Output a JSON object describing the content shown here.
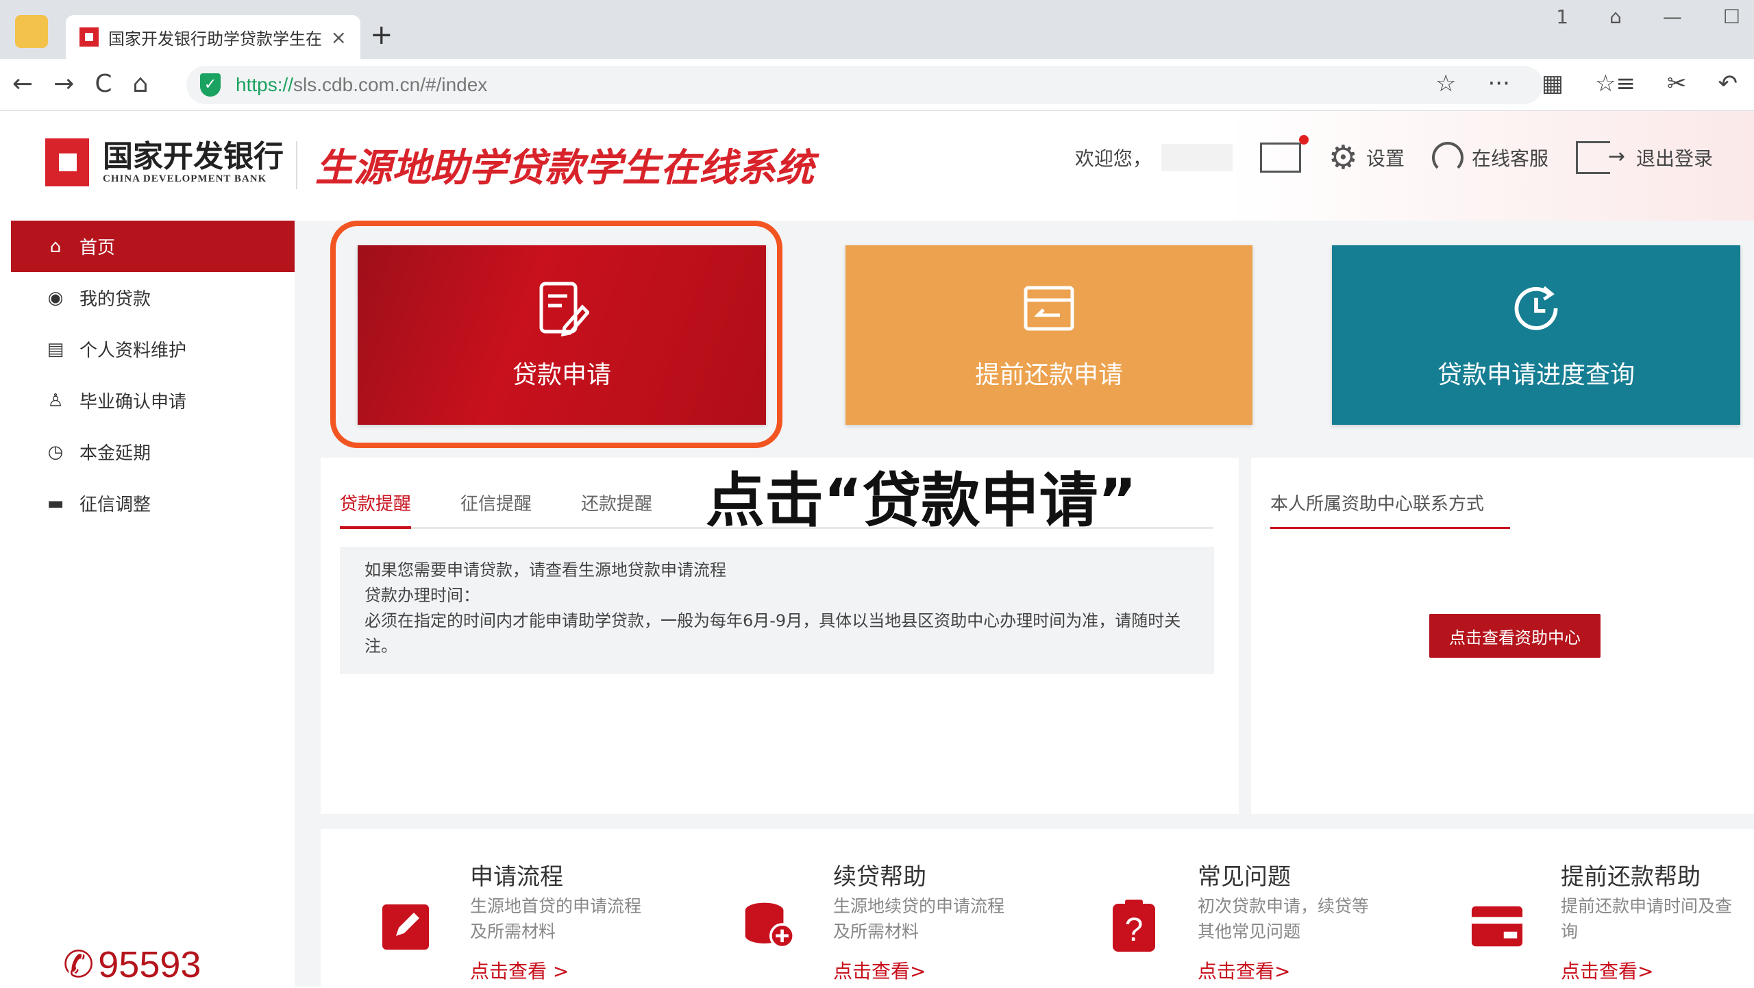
{
  "browser": {
    "tab_title": "国家开发银行助学贷款学生在",
    "tab_close": "×",
    "new_tab": "+",
    "url_proto": "https://",
    "url_rest": "sls.cdb.com.cn/#/index",
    "window_controls": [
      "1",
      "⌂",
      "—",
      "☐"
    ],
    "nav": [
      "←",
      "→",
      "C",
      "⌂"
    ],
    "addr_icons": [
      "☆",
      "···",
      "▦",
      "☆≡",
      "✂",
      "↶"
    ]
  },
  "header": {
    "bank_name": "国家开发银行",
    "bank_eng": "CHINA DEVELOPMENT BANK",
    "system_name": "生源地助学贷款学生在线系统",
    "welcome": "欢迎您，",
    "settings": "设置",
    "service": "在线客服",
    "logout": "退出登录"
  },
  "sidebar": {
    "items": [
      {
        "label": "首页",
        "icon": "home-icon"
      },
      {
        "label": "我的贷款",
        "icon": "loan-user-icon"
      },
      {
        "label": "个人资料维护",
        "icon": "id-card-icon"
      },
      {
        "label": "毕业确认申请",
        "icon": "graduate-icon"
      },
      {
        "label": "本金延期",
        "icon": "clock-icon"
      },
      {
        "label": "征信调整",
        "icon": "card-icon"
      }
    ],
    "phone": "95593"
  },
  "tiles": [
    {
      "label": "贷款申请",
      "color": "#c8111d"
    },
    {
      "label": "提前还款申请",
      "color": "#eca24e"
    },
    {
      "label": "贷款申请进度查询",
      "color": "#167e93"
    }
  ],
  "annotation": "点击“贷款申请”",
  "notice_panel": {
    "tabs": [
      "贷款提醒",
      "征信提醒",
      "还款提醒"
    ],
    "lines": [
      "如果您需要申请贷款，请查看生源地贷款申请流程",
      "贷款办理时间：",
      "必须在指定的时间内才能申请助学贷款，一般为每年6月-9月，具体以当地县区资助中心办理时间为准，请随时关注。"
    ]
  },
  "contact_panel": {
    "title": "本人所属资助中心联系方式",
    "button": "点击查看资助中心"
  },
  "help_cards": [
    {
      "title": "申请流程",
      "desc": "生源地首贷的申请流程及所需材料",
      "link": "点击查看 >",
      "icon": "edit-icon"
    },
    {
      "title": "续贷帮助",
      "desc": "生源地续贷的申请流程及所需材料",
      "link": "点击查看>",
      "icon": "coins-plus-icon"
    },
    {
      "title": "常见问题",
      "desc": "初次贷款申请，续贷等其他常见问题",
      "link": "点击查看>",
      "icon": "question-icon"
    },
    {
      "title": "提前还款帮助",
      "desc": "提前还款申请时间及查询",
      "link": "点击查看>",
      "icon": "wallet-icon"
    }
  ],
  "colors": {
    "brand_red": "#c8111d",
    "highlight": "#f25522"
  }
}
